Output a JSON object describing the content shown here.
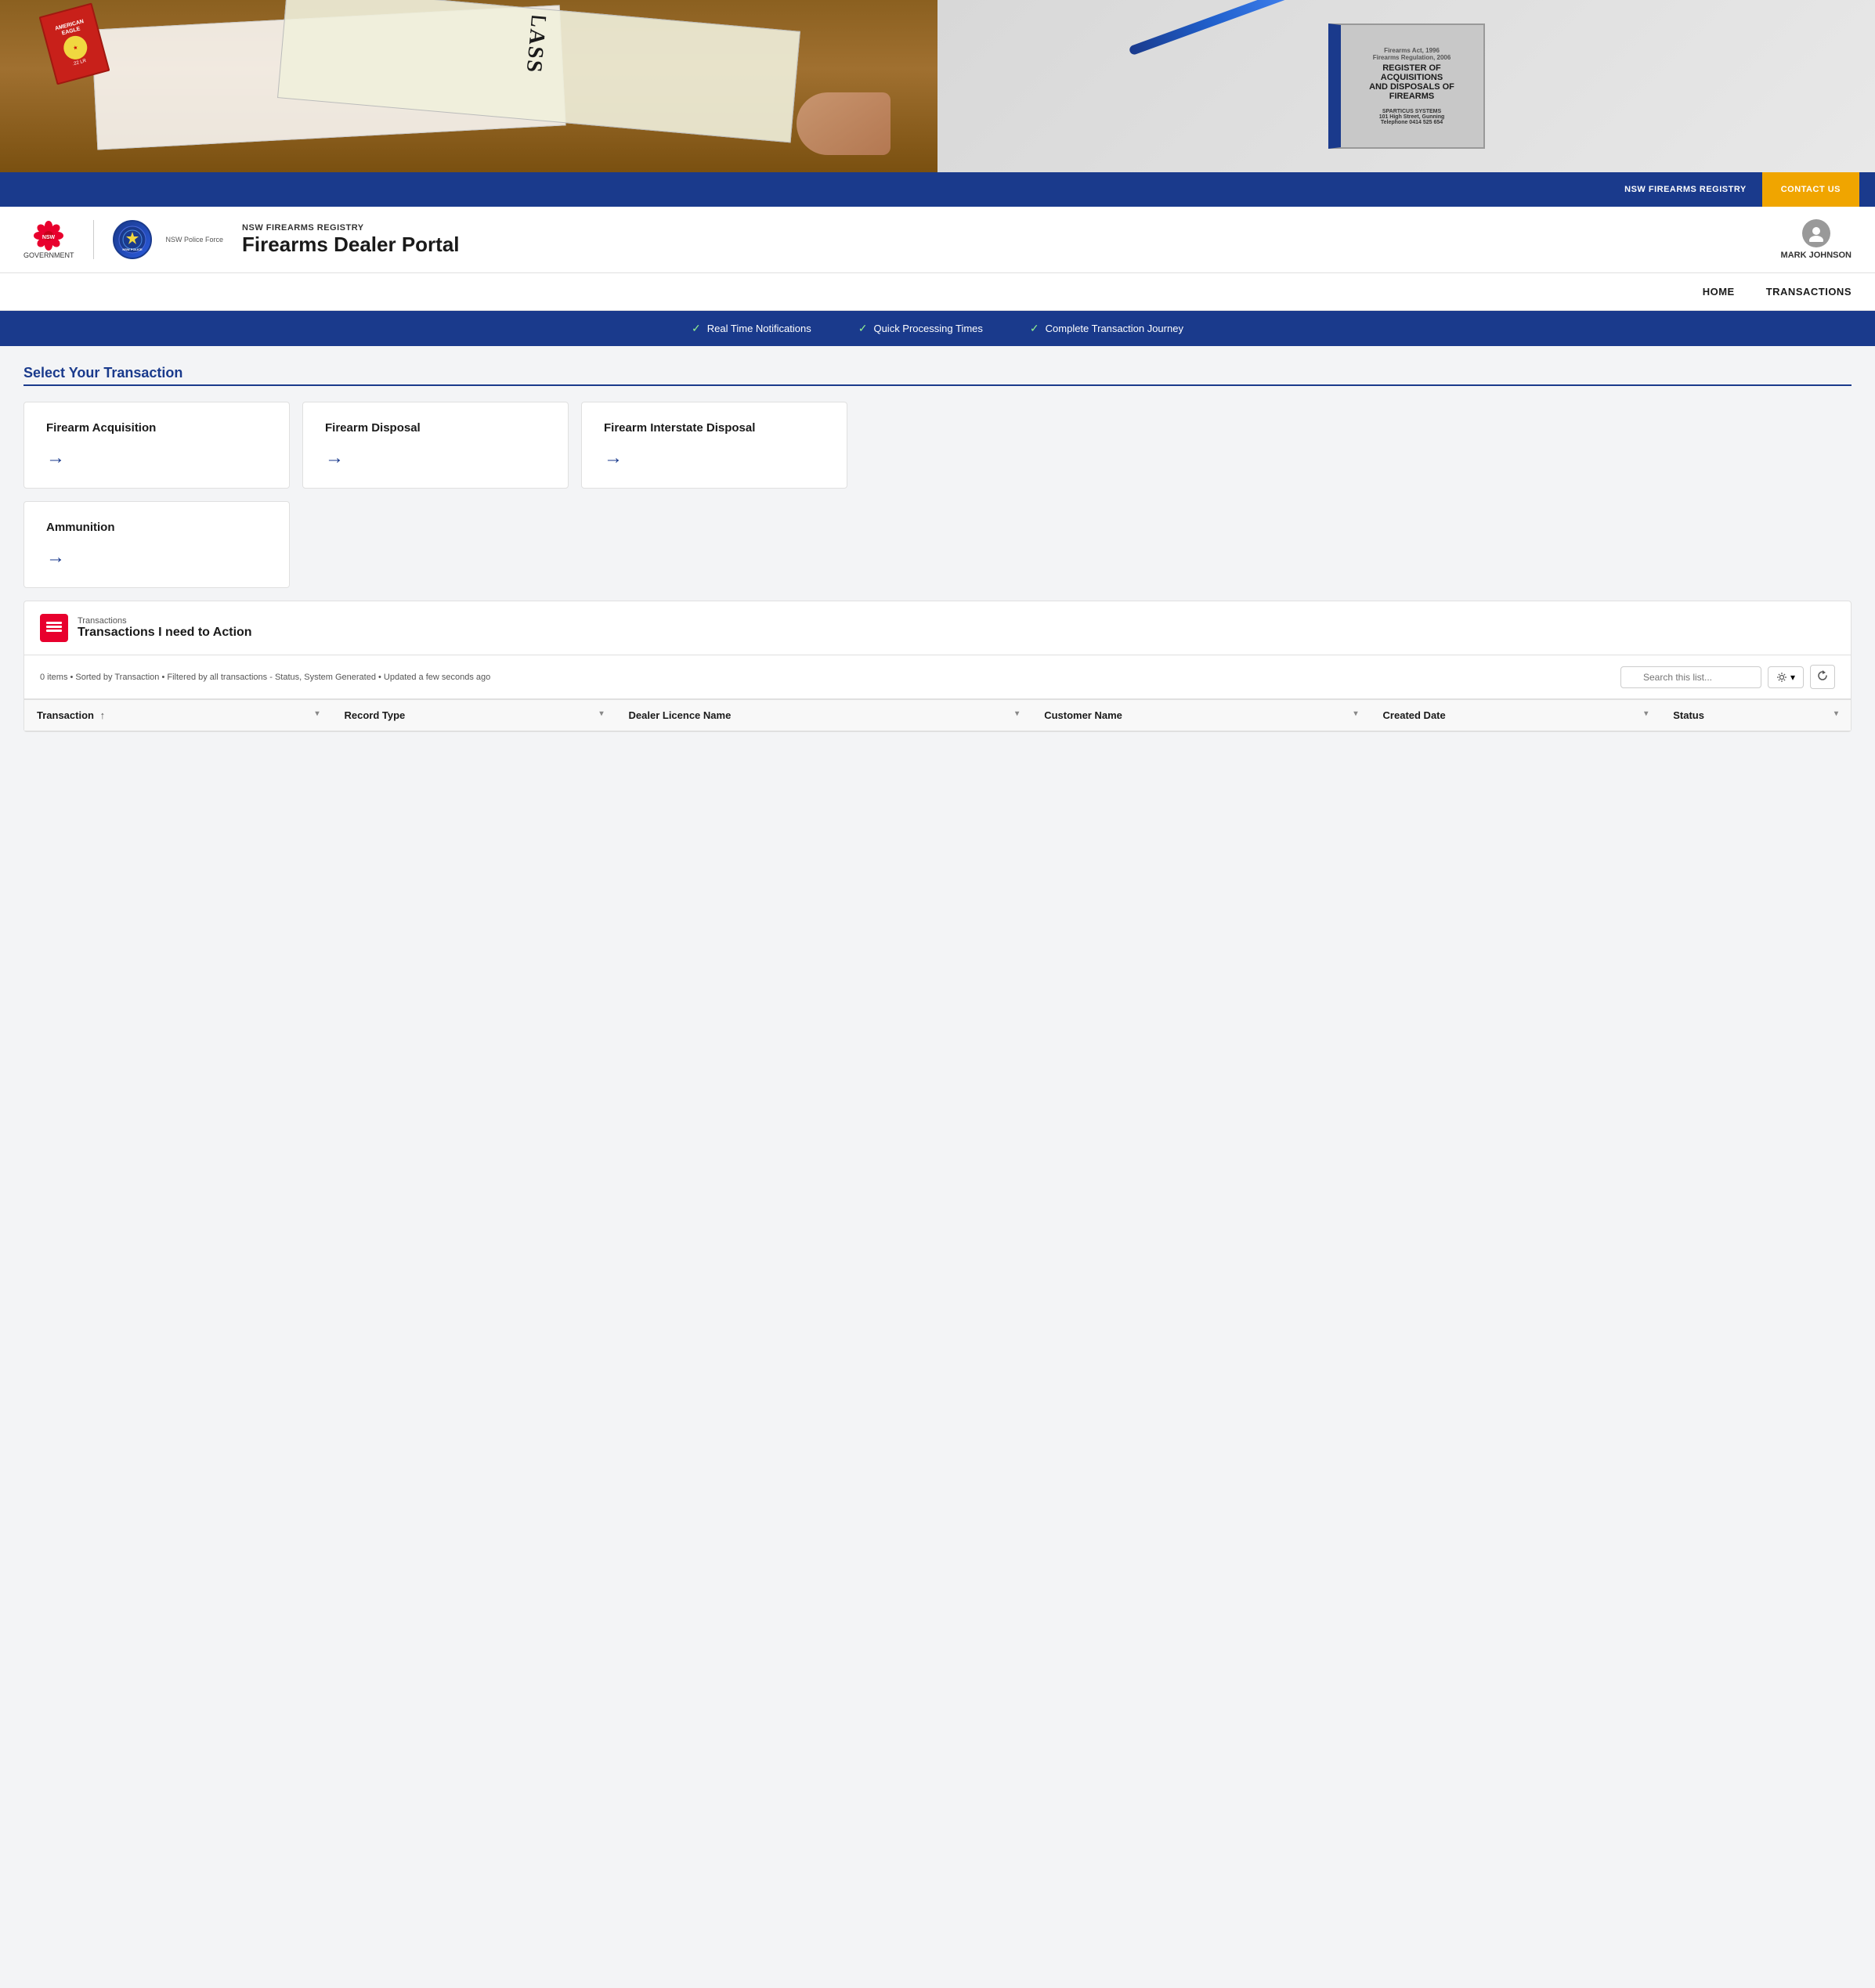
{
  "hero": {
    "left_alt": "Person filling out forms with ammunition box",
    "right_alt": "Register of Acquisitions and Disposals of Firearms book"
  },
  "top_nav": {
    "registry_label": "NSW FIREARMS REGISTRY",
    "contact_label": "CONTACT US"
  },
  "header": {
    "nsw_label": "NSW",
    "gov_label": "GOVERNMENT",
    "police_label": "NSW Police Force",
    "subtitle": "NSW FIREARMS REGISTRY",
    "title": "Firearms Dealer Portal",
    "user_name": "MARK JOHNSON"
  },
  "main_nav": {
    "items": [
      {
        "label": "HOME"
      },
      {
        "label": "TRANSACTIONS"
      }
    ]
  },
  "features": [
    {
      "label": "Real Time Notifications"
    },
    {
      "label": "Quick Processing Times"
    },
    {
      "label": "Complete Transaction Journey"
    }
  ],
  "select_transaction": {
    "title": "Select Your Transaction",
    "cards": [
      {
        "title": "Firearm Acquisition",
        "arrow": "→"
      },
      {
        "title": "Firearm Disposal",
        "arrow": "→"
      },
      {
        "title": "Firearm Interstate Disposal",
        "arrow": "→"
      },
      {
        "title": "Ammunition",
        "arrow": "→"
      }
    ]
  },
  "transactions_panel": {
    "label": "Transactions",
    "title": "Transactions I need to Action",
    "status": "0 items • Sorted by Transaction • Filtered by all transactions - Status, System Generated • Updated a few seconds ago",
    "search_placeholder": "Search this list...",
    "columns": [
      {
        "label": "Transaction",
        "has_sort": true,
        "has_filter": true
      },
      {
        "label": "Record Type",
        "has_sort": false,
        "has_filter": true
      },
      {
        "label": "Dealer Licence Name",
        "has_sort": false,
        "has_filter": true
      },
      {
        "label": "Customer Name",
        "has_sort": false,
        "has_filter": true
      },
      {
        "label": "Created Date",
        "has_sort": false,
        "has_filter": true
      },
      {
        "label": "Status",
        "has_sort": false,
        "has_filter": true
      }
    ],
    "rows": []
  }
}
